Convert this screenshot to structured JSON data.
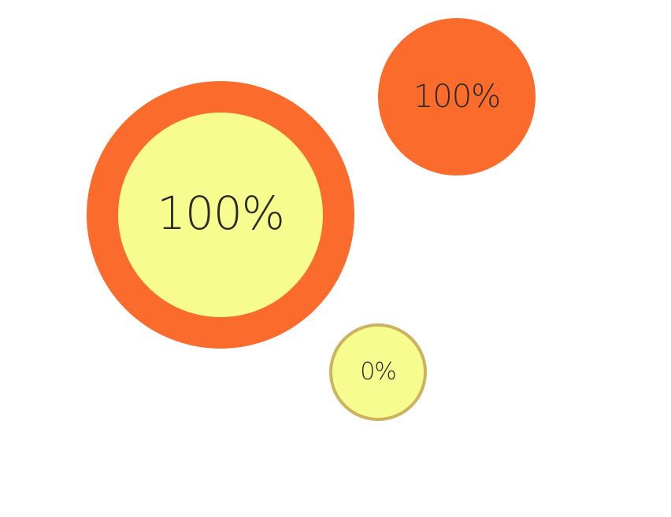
{
  "gauges": {
    "large": {
      "label": "100%",
      "value": 100,
      "ring_color": "#fb6b2c",
      "fill_color": "#f7fc8f"
    },
    "medium": {
      "label": "100%",
      "value": 100,
      "fill_color": "#fb6b2c"
    },
    "small": {
      "label": "0%",
      "value": 0,
      "fill_color": "#f7fc8f",
      "border_color": "#cdb25f"
    }
  },
  "text_color": "#2a2a2a",
  "background_color": "#ffffff"
}
